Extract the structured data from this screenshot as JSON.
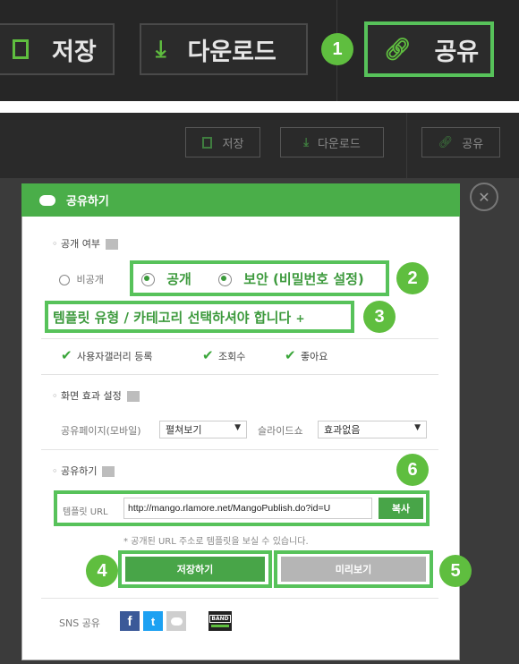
{
  "toolbar_zoom": {
    "save_label": "저장",
    "download_label": "다운로드",
    "share_label": "공유",
    "badge_1": "1"
  },
  "toolbar_dim": {
    "save_label": "저장",
    "download_label": "다운로드",
    "share_label": "공유"
  },
  "dialog": {
    "title": "공유하기",
    "close_glyph": "✕",
    "visibility": {
      "heading": "공개 여부",
      "private_label": "비공개",
      "public_label": "공개",
      "secure_label": "보안 (비밀번호 설정)",
      "selected": "public",
      "badge": "2"
    },
    "template_type_notice": "템플릿 유형 / 카테고리 선택하셔야 합니다",
    "template_type_plus": "+",
    "badge_3": "3",
    "checkboxes": [
      {
        "label": "사용자갤러리 등록",
        "checked": true
      },
      {
        "label": "조회수",
        "checked": true
      },
      {
        "label": "좋아요",
        "checked": true
      }
    ],
    "effects": {
      "heading": "화면 효과 설정",
      "share_page_label": "공유페이지(모바일)",
      "share_page_value": "펼쳐보기",
      "slideshow_label": "슬라이드쇼",
      "slideshow_value": "효과없음"
    },
    "share": {
      "heading": "공유하기",
      "badge": "6",
      "url_label": "템플릿 URL",
      "url_value": "http://mango.rlamore.net/MangoPublish.do?id=U",
      "copy_label": "복사",
      "hint": "* 공개된 URL 주소로 템플릿을 보실 수 있습니다."
    },
    "save_button": "저장하기",
    "preview_button": "미리보기",
    "badge_4": "4",
    "badge_5": "5",
    "sns": {
      "label": "SNS 공유",
      "facebook": "f",
      "twitter": "t",
      "band": "BAND"
    }
  },
  "colors": {
    "accent_green": "#4aae49",
    "highlight_green": "#57c25a",
    "dark_bg": "#262626"
  }
}
